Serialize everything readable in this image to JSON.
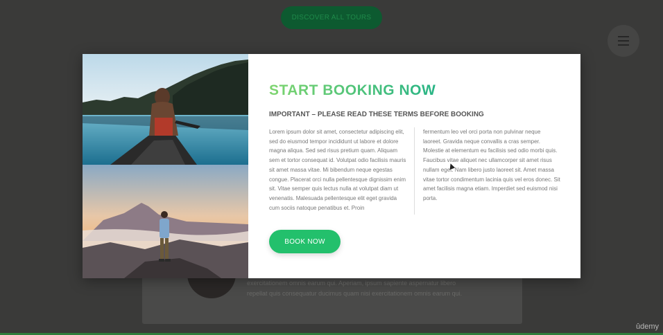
{
  "background": {
    "discover_label": "DISCOVER ALL TOURS",
    "text_line_1": "exercitationem omnis earum qui. Aperiam, ipsum sapiente aspernatur libero",
    "text_line_2": "repellat quis consequatur ducimus quam nisi exercitationem omnis earum qui."
  },
  "popup": {
    "title": "START BOOKING NOW",
    "subtitle": "IMPORTANT – PLEASE READ THESE TERMS BEFORE BOOKING",
    "column_1": "Lorem ipsum dolor sit amet, consectetur adipiscing elit, sed do eiusmod tempor incididunt ut labore et dolore magna aliqua. Sed sed risus pretium quam. Aliquam sem et tortor consequat id. Volutpat odio facilisis mauris sit amet massa vitae. Mi bibendum neque egestas congue. Placerat orci nulla pellentesque dignissim enim sit. Vitae semper quis lectus nulla at volutpat diam ut venenatis. Malesuada pellentesque elit eget gravida cum sociis natoque penatibus et. Proin",
    "column_2": "fermentum leo vel orci porta non pulvinar neque laoreet. Gravida neque convallis a cras semper. Molestie at elementum eu facilisis sed odio morbi quis. Faucibus vitae aliquet nec ullamcorper sit amet risus nullam eget. Nam libero justo laoreet sit. Amet massa vitae tortor condimentum lacinia quis vel eros donec. Sit amet facilisis magna etiam. Imperdiet sed euismod nisi porta.",
    "button_label": "BOOK NOW"
  },
  "watermark": "ûdemy",
  "colors": {
    "title_gradient_start": "#7ed56f",
    "title_gradient_end": "#28b485",
    "button": "#23c06c"
  },
  "icons": {
    "menu": "hamburger-menu-icon"
  }
}
